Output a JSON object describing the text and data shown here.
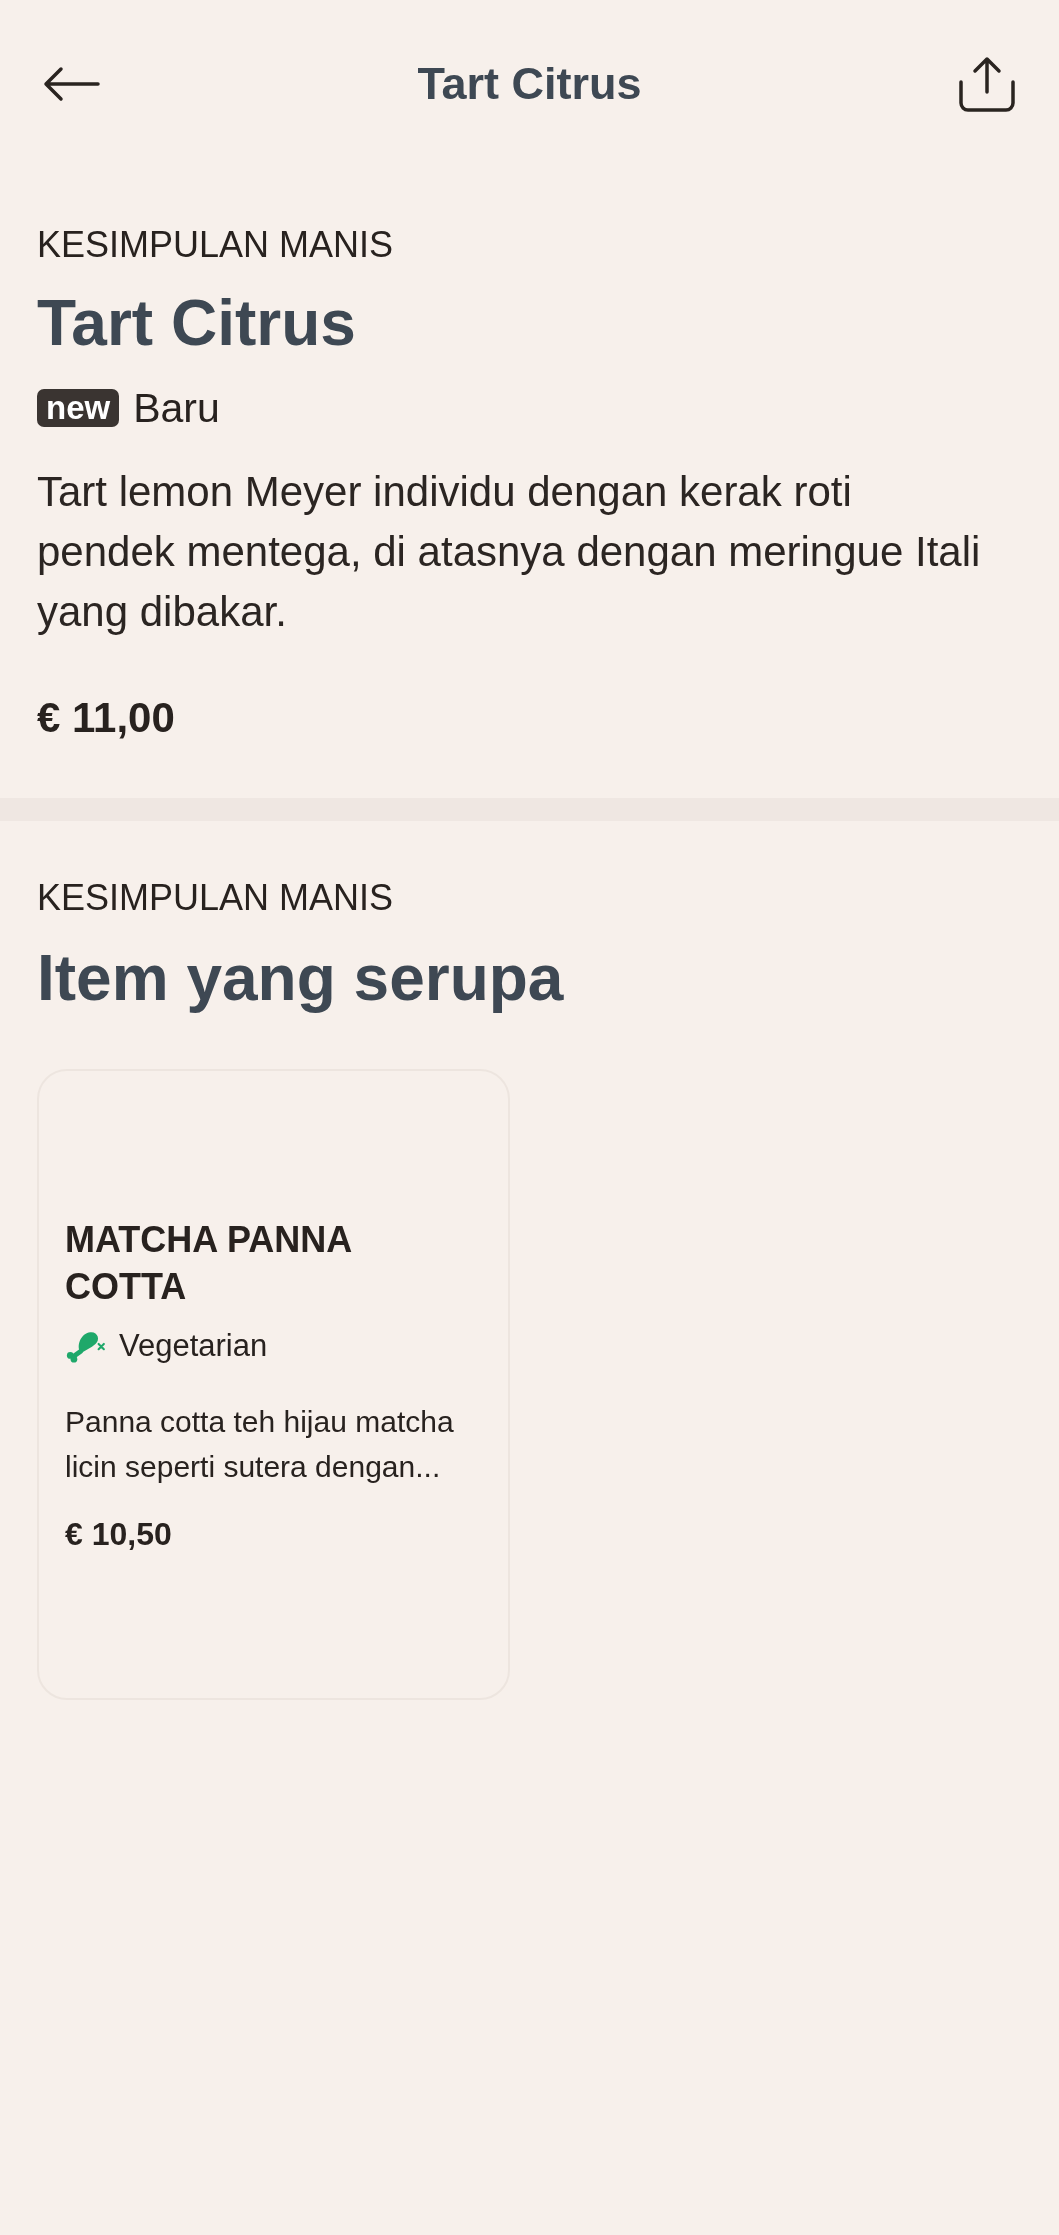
{
  "header": {
    "title": "Tart Citrus"
  },
  "product": {
    "category": "KESIMPULAN MANIS",
    "name": "Tart Citrus",
    "tag": "new",
    "status": "Baru",
    "description": "Tart lemon Meyer individu dengan kerak roti pendek mentega, di atasnya dengan meringue Itali yang dibakar.",
    "price": "€ 11,00"
  },
  "similar": {
    "category": "KESIMPULAN MANIS",
    "title": "Item yang serupa",
    "items": [
      {
        "name": "MATCHA PANNA COTTA",
        "diet": {
          "kind": "vegetarian",
          "label": "Vegetarian"
        },
        "description": "Panna cotta teh hijau matcha licin seperti sutera dengan...",
        "price": "€ 10,50"
      }
    ]
  }
}
